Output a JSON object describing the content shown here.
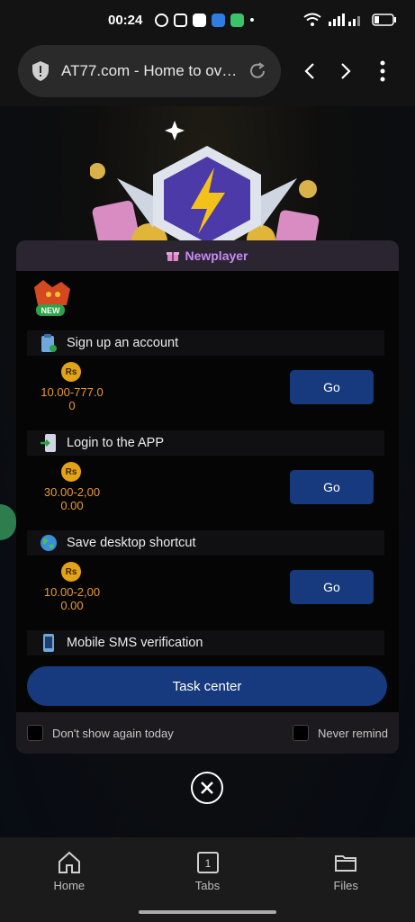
{
  "status_bar": {
    "time": "00:24"
  },
  "browser": {
    "url_title": "AT77.com - Home to ov…"
  },
  "modal": {
    "title": "Newplayer",
    "badge": "NEW",
    "coin_symbol": "Rs",
    "tasks": [
      {
        "title": "Sign up an account",
        "reward_line1": "10.00-777.0",
        "reward_line2": "0",
        "button": "Go"
      },
      {
        "title": "Login to the APP",
        "reward_line1": "30.00-2,00",
        "reward_line2": "0.00",
        "button": "Go"
      },
      {
        "title": "Save desktop shortcut",
        "reward_line1": "10.00-2,00",
        "reward_line2": "0.00",
        "button": "Go"
      },
      {
        "title": "Mobile SMS verification"
      }
    ],
    "task_center": "Task center",
    "dont_show": "Don't show again today",
    "never_remind": "Never remind"
  },
  "bottom_nav": {
    "home": "Home",
    "tabs": "Tabs",
    "tabs_count": "1",
    "files": "Files"
  },
  "colors": {
    "accent": "#163a7d",
    "title": "#c98af4",
    "reward": "#e89a2a"
  }
}
